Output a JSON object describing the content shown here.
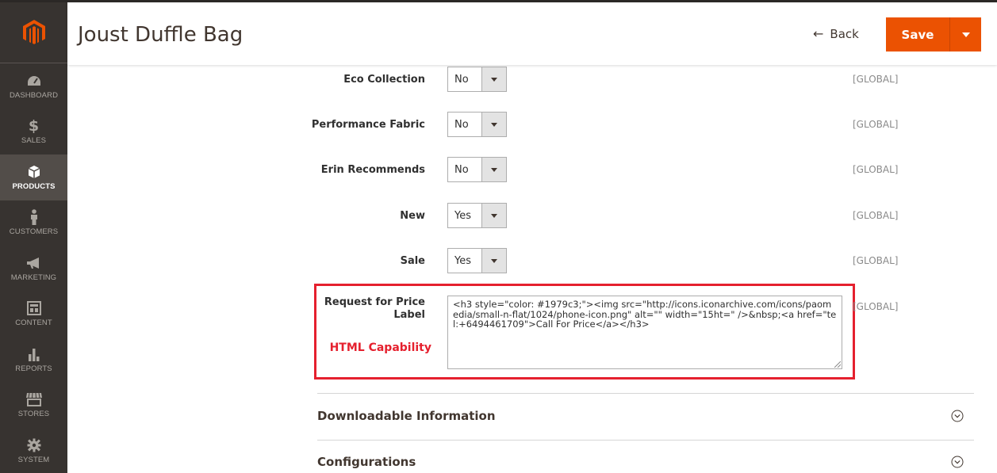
{
  "header": {
    "title": "Joust Duffle Bag",
    "back_label": "Back",
    "save_label": "Save"
  },
  "sidebar": {
    "items": [
      {
        "label": "DASHBOARD",
        "icon": "dashboard-icon"
      },
      {
        "label": "SALES",
        "icon": "dollar-icon"
      },
      {
        "label": "PRODUCTS",
        "icon": "box-icon"
      },
      {
        "label": "CUSTOMERS",
        "icon": "person-icon"
      },
      {
        "label": "MARKETING",
        "icon": "megaphone-icon"
      },
      {
        "label": "CONTENT",
        "icon": "layout-icon"
      },
      {
        "label": "REPORTS",
        "icon": "bar-chart-icon"
      },
      {
        "label": "STORES",
        "icon": "storefront-icon"
      },
      {
        "label": "SYSTEM",
        "icon": "gear-icon"
      }
    ],
    "active": "PRODUCTS"
  },
  "fields": [
    {
      "label": "Eco Collection",
      "value": "No",
      "scope": "[GLOBAL]"
    },
    {
      "label": "Performance Fabric",
      "value": "No",
      "scope": "[GLOBAL]"
    },
    {
      "label": "Erin Recommends",
      "value": "No",
      "scope": "[GLOBAL]"
    },
    {
      "label": "New",
      "value": "Yes",
      "scope": "[GLOBAL]"
    },
    {
      "label": "Sale",
      "value": "Yes",
      "scope": "[GLOBAL]"
    }
  ],
  "request_price": {
    "label_line1": "Request for Price",
    "label_line2": "Label",
    "annotation": "HTML Capability",
    "value": "<h3 style=\"color: #1979c3;\"><img src=\"http://icons.iconarchive.com/icons/paomedia/small-n-flat/1024/phone-icon.png\" alt=\"\" width=\"15ht=\" />&nbsp;<a href=\"tel:+6494461709\">Call For Price</a></h3>",
    "scope": "[GLOBAL]"
  },
  "sections": [
    {
      "title": "Downloadable Information"
    },
    {
      "title": "Configurations"
    }
  ],
  "colors": {
    "accent": "#eb5202",
    "highlight": "#e5202e",
    "sidebar_bg": "#373330"
  }
}
